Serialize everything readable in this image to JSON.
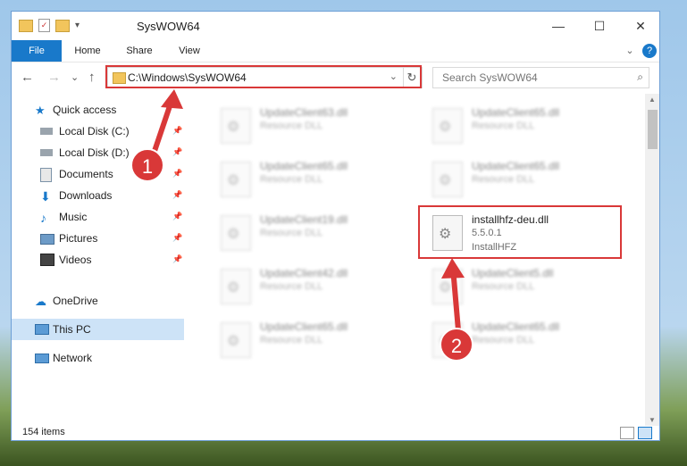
{
  "window": {
    "title": "SysWOW64",
    "controls": {
      "minimize": "—",
      "maximize": "☐",
      "close": "✕"
    }
  },
  "ribbon": {
    "tabs": [
      "File",
      "Home",
      "Share",
      "View"
    ],
    "expand": "⌄",
    "help": "?"
  },
  "nav": {
    "back": "←",
    "forward": "→",
    "recent": "⌄",
    "up": "↑",
    "address": "C:\\Windows\\SysWOW64",
    "address_dropdown": "⌄",
    "refresh": "↻",
    "search_placeholder": "Search SysWOW64",
    "search_icon": "⌕"
  },
  "sidebar": {
    "items": [
      {
        "label": "Quick access",
        "icon": "star-icon",
        "pinned": false
      },
      {
        "label": "Local Disk (C:)",
        "icon": "drive-icon",
        "pinned": true
      },
      {
        "label": "Local Disk (D:)",
        "icon": "drive-icon",
        "pinned": true
      },
      {
        "label": "Documents",
        "icon": "documents-icon",
        "pinned": true
      },
      {
        "label": "Downloads",
        "icon": "downloads-icon",
        "pinned": true
      },
      {
        "label": "Music",
        "icon": "music-icon",
        "pinned": true
      },
      {
        "label": "Pictures",
        "icon": "pictures-icon",
        "pinned": true
      },
      {
        "label": "Videos",
        "icon": "videos-icon",
        "pinned": true
      },
      {
        "label": "OneDrive",
        "icon": "cloud-icon",
        "pinned": false
      },
      {
        "label": "This PC",
        "icon": "computer-icon",
        "pinned": false,
        "selected": true
      },
      {
        "label": "Network",
        "icon": "network-icon",
        "pinned": false
      }
    ]
  },
  "files": [
    {
      "name": "UpdateClient63.dll",
      "desc": "Resource DLL",
      "blurred": true
    },
    {
      "name": "UpdateClient65.dll",
      "desc": "Resource DLL",
      "blurred": true
    },
    {
      "name": "UpdateClient65.dll",
      "desc": "Resource DLL",
      "blurred": true
    },
    {
      "name": "UpdateClient65.dll",
      "desc": "Resource DLL",
      "blurred": true
    },
    {
      "name": "UpdateClient19.dll",
      "desc": "Resource DLL",
      "blurred": true
    },
    {
      "name": "installhfz-deu.dll",
      "desc": "5.5.0.1",
      "desc2": "InstallHFZ",
      "blurred": false
    },
    {
      "name": "UpdateClient42.dll",
      "desc": "Resource DLL",
      "blurred": true
    },
    {
      "name": "UpdateClient5.dll",
      "desc": "Resource DLL",
      "blurred": true
    },
    {
      "name": "UpdateClient65.dll",
      "desc": "Resource DLL",
      "blurred": true
    },
    {
      "name": "UpdateClient65.dll",
      "desc": "Resource DLL",
      "blurred": true
    }
  ],
  "status": {
    "count": "154 items"
  },
  "annotations": {
    "step1": "1",
    "step2": "2"
  },
  "colors": {
    "accent": "#1979ca",
    "highlight": "#d93838",
    "selected": "#cde3f7"
  }
}
